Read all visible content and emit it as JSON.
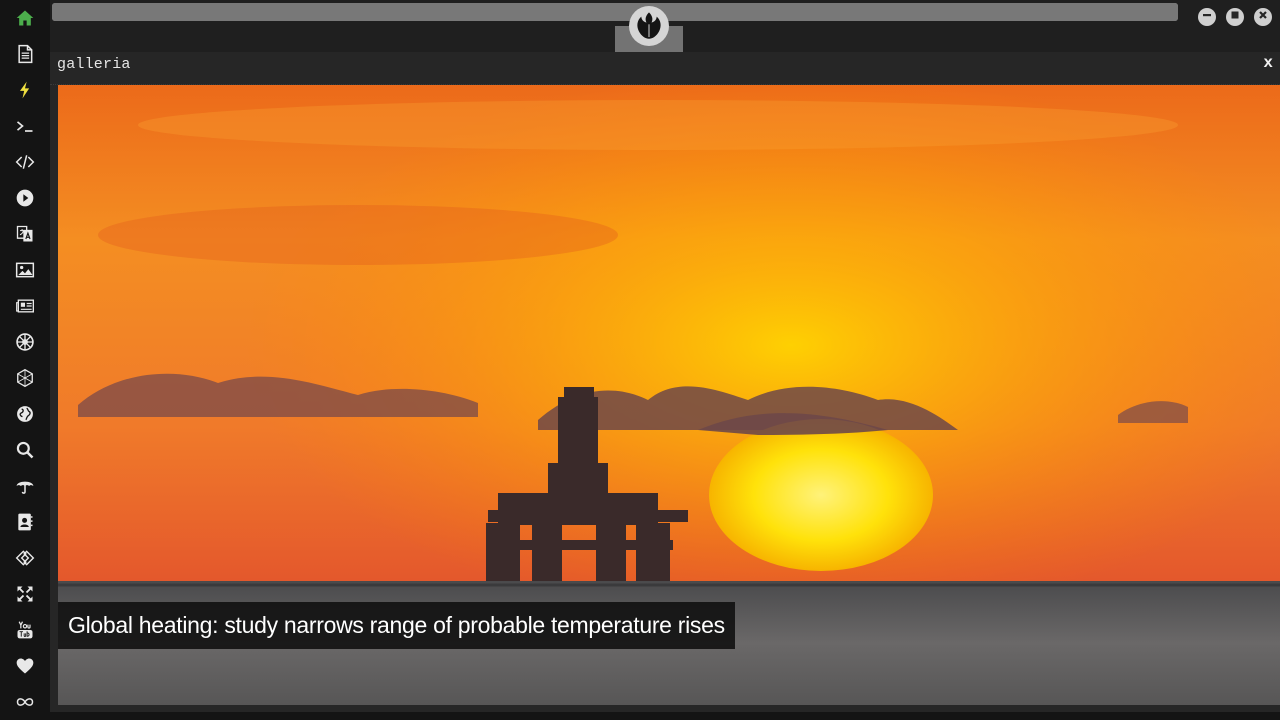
{
  "sidebar": {
    "items": [
      {
        "name": "home-icon",
        "color": "#4cae4c"
      },
      {
        "name": "document-icon",
        "color": "#e8e8e8"
      },
      {
        "name": "lightning-icon",
        "color": "#f0e040"
      },
      {
        "name": "terminal-icon",
        "color": "#e8e8e8"
      },
      {
        "name": "code-icon",
        "color": "#e8e8e8"
      },
      {
        "name": "play-icon",
        "color": "#e8e8e8"
      },
      {
        "name": "translate-icon",
        "color": "#e8e8e8"
      },
      {
        "name": "image-icon",
        "color": "#e8e8e8"
      },
      {
        "name": "newspaper-icon",
        "color": "#e8e8e8"
      },
      {
        "name": "empire-icon",
        "color": "#e8e8e8"
      },
      {
        "name": "deathstar-icon",
        "color": "#e8e8e8"
      },
      {
        "name": "globe-icon",
        "color": "#e8e8e8"
      },
      {
        "name": "search-icon",
        "color": "#e8e8e8"
      },
      {
        "name": "umbrella-icon",
        "color": "#e8e8e8"
      },
      {
        "name": "contacts-icon",
        "color": "#e8e8e8"
      },
      {
        "name": "connection-icon",
        "color": "#e8e8e8"
      },
      {
        "name": "fullscreen-icon",
        "color": "#e8e8e8"
      },
      {
        "name": "youtube-icon",
        "color": "#e8e8e8"
      },
      {
        "name": "heart-icon",
        "color": "#e8e8e8"
      },
      {
        "name": "infinity-icon",
        "color": "#e8e8e8"
      }
    ]
  },
  "topbar": {
    "logo_icon": "rebel-alliance-icon",
    "window_controls": [
      "minimize-icon",
      "maximize-icon",
      "close-icon"
    ],
    "progress": 1.0
  },
  "panel": {
    "title": "galleria",
    "close_label": "x"
  },
  "gallery": {
    "caption": "Global heating: study narrows range of probable temperature rises"
  },
  "colors": {
    "accent_green": "#4cae4c",
    "accent_yellow": "#f0e040",
    "background": "#141414",
    "panel": "#262626"
  }
}
